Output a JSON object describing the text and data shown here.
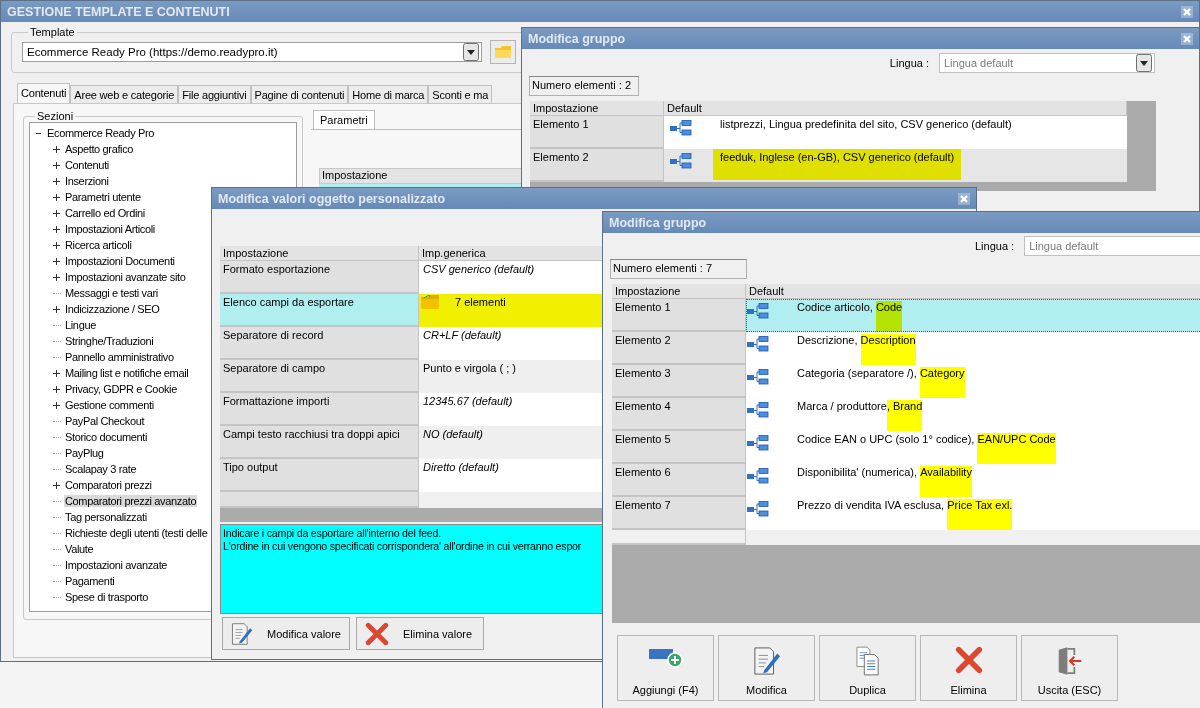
{
  "main_window": {
    "title": "GESTIONE TEMPLATE E CONTENUTI",
    "template": {
      "label": "Template",
      "value": "Ecommerce Ready Pro (https://demo.readypro.it)"
    },
    "tabs": [
      {
        "label": "Contenuti",
        "selected": true
      },
      {
        "label": "Aree web e categorie",
        "selected": false
      },
      {
        "label": "File aggiuntivi",
        "selected": false
      },
      {
        "label": "Pagine di contenuti",
        "selected": false
      },
      {
        "label": "Home di marca",
        "selected": false
      },
      {
        "label": "Sconti e ma",
        "selected": false
      }
    ],
    "sections": {
      "label": "Sezioni",
      "tree": {
        "label": "Ecommerce Ready Pro",
        "expanded": true,
        "children": [
          {
            "label": "Aspetto grafico",
            "expandable": true,
            "selected": false
          },
          {
            "label": "Contenuti",
            "expandable": true,
            "selected": false
          },
          {
            "label": "Inserzioni",
            "expandable": true,
            "selected": false
          },
          {
            "label": "Parametri utente",
            "expandable": true,
            "selected": false
          },
          {
            "label": "Carrello ed Ordini",
            "expandable": true,
            "selected": false
          },
          {
            "label": "Impostazioni Articoli",
            "expandable": true,
            "selected": false
          },
          {
            "label": "Ricerca articoli",
            "expandable": true,
            "selected": false
          },
          {
            "label": "Impostazioni Documenti",
            "expandable": true,
            "selected": false
          },
          {
            "label": "Impostazioni avanzate sito",
            "expandable": true,
            "selected": false
          },
          {
            "label": "Messaggi e testi vari",
            "expandable": false,
            "selected": false
          },
          {
            "label": "Indicizzazione / SEO",
            "expandable": true,
            "selected": false
          },
          {
            "label": "Lingue",
            "expandable": false,
            "selected": false
          },
          {
            "label": "Stringhe/Traduzioni",
            "expandable": false,
            "selected": false
          },
          {
            "label": "Pannello amministrativo",
            "expandable": false,
            "selected": false
          },
          {
            "label": "Mailing list e notifiche email",
            "expandable": true,
            "selected": false
          },
          {
            "label": "Privacy, GDPR e Cookie",
            "expandable": true,
            "selected": false
          },
          {
            "label": "Gestione commenti",
            "expandable": true,
            "selected": false
          },
          {
            "label": "PayPal Checkout",
            "expandable": false,
            "selected": false
          },
          {
            "label": "Storico documenti",
            "expandable": false,
            "selected": false
          },
          {
            "label": "PayPlug",
            "expandable": false,
            "selected": false
          },
          {
            "label": "Scalapay 3 rate",
            "expandable": false,
            "selected": false
          },
          {
            "label": "Comparatori prezzi",
            "expandable": true,
            "selected": false
          },
          {
            "label": "Comparatori prezzi avanzato",
            "expandable": false,
            "selected": true
          },
          {
            "label": "Tag personalizzati",
            "expandable": false,
            "selected": false
          },
          {
            "label": "Richieste degli utenti (testi delle",
            "expandable": false,
            "selected": false
          },
          {
            "label": "Valute",
            "expandable": false,
            "selected": false
          },
          {
            "label": "Impostazioni avanzate",
            "expandable": false,
            "selected": false
          },
          {
            "label": "Pagamenti",
            "expandable": false,
            "selected": false
          },
          {
            "label": "Spese di trasporto",
            "expandable": false,
            "selected": false
          }
        ]
      }
    },
    "params": {
      "tab": "Parametri",
      "column": "Impostazione"
    }
  },
  "group_window_back": {
    "title": "Modifica gruppo",
    "language_label": "Lingua :",
    "language": "Lingua default",
    "count": "Numero elementi : 2",
    "columns": [
      "Impostazione",
      "Default"
    ],
    "rows": [
      {
        "label": "Elemento 1",
        "value": "listprezzi, Lingua predefinita del sito, CSV generico (default)",
        "highlighted": false
      },
      {
        "label": "Elemento 2",
        "value": "feeduk, Inglese (en-GB), CSV generico (default)",
        "highlighted": true
      }
    ]
  },
  "values_window": {
    "title": "Modifica valori oggetto personalizzato",
    "columns": [
      "Impostazione",
      "Imp.generica"
    ],
    "rows": [
      {
        "label": "Formato esportazione",
        "value": "CSV generico (default)",
        "kind": "text",
        "is_default": true,
        "selected": false
      },
      {
        "label": "Elenco campi da esportare",
        "value": "7 elementi",
        "kind": "group",
        "is_default": false,
        "selected": true
      },
      {
        "label": "Separatore di record",
        "value": "CR+LF (default)",
        "kind": "text",
        "is_default": true,
        "selected": false
      },
      {
        "label": "Separatore di campo",
        "value": "Punto e virgola ( ; )",
        "kind": "text",
        "is_default": false,
        "selected": false
      },
      {
        "label": "Formattazione importi",
        "value": "12345.67 (default)",
        "kind": "text",
        "is_default": true,
        "selected": false
      },
      {
        "label": "Campi testo racchiusi tra doppi apici",
        "value": "NO (default)",
        "kind": "text",
        "is_default": true,
        "selected": false
      },
      {
        "label": "Tipo output",
        "value": "Diretto (default)",
        "kind": "text",
        "is_default": true,
        "selected": false
      }
    ],
    "description": [
      "Indicare i campi da esportare all'interno del feed.",
      "L'ordine in cui vengono specificati corrispondera' all'ordine in cui verranno espor"
    ],
    "buttons": [
      {
        "label": "Modifica valore",
        "kind": "edit"
      },
      {
        "label": "Elimina valore",
        "kind": "delete"
      }
    ]
  },
  "group_window_front": {
    "title": "Modifica gruppo",
    "language_label": "Lingua :",
    "language": "Lingua default",
    "count": "Numero elementi : 7",
    "columns": [
      "Impostazione",
      "Default"
    ],
    "rows": [
      {
        "label": "Elemento 1",
        "value": "Codice articolo, ",
        "highlight": "Code",
        "selected": true
      },
      {
        "label": "Elemento 2",
        "value": "Descrizione, ",
        "highlight": "Description",
        "selected": false
      },
      {
        "label": "Elemento 3",
        "value": "Categoria (separatore /), ",
        "highlight": "Category",
        "selected": false
      },
      {
        "label": "Elemento 4",
        "value": "Marca / produttore",
        "highlight": ", Brand",
        "selected": false
      },
      {
        "label": "Elemento 5",
        "value": "Codice EAN o UPC (solo 1° codice), ",
        "highlight": "EAN/UPC Code",
        "selected": false
      },
      {
        "label": "Elemento 6",
        "value": "Disponibilita' (numerica), ",
        "highlight": "Availability",
        "selected": false
      },
      {
        "label": "Elemento 7",
        "value": "Prezzo di vendita IVA esclusa, ",
        "highlight": "Price Tax exl.",
        "selected": false
      }
    ],
    "buttons": [
      {
        "label": "Aggiungi (F4)",
        "kind": "add"
      },
      {
        "label": "Modifica",
        "kind": "edit"
      },
      {
        "label": "Duplica",
        "kind": "duplicate"
      },
      {
        "label": "Elimina",
        "kind": "delete"
      },
      {
        "label": "Uscita (ESC)",
        "kind": "exit"
      }
    ]
  }
}
